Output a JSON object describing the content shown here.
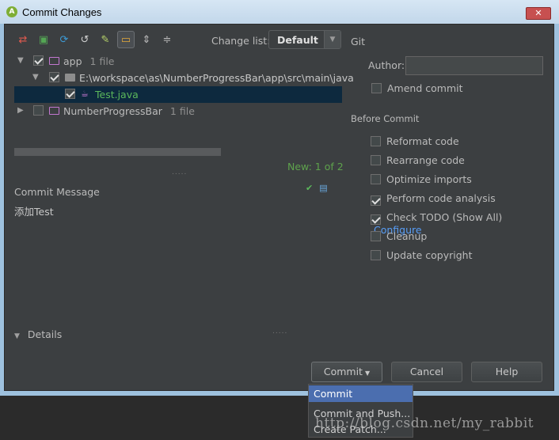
{
  "window": {
    "title": "Commit Changes",
    "close": "✕"
  },
  "toolbar": {
    "icons": [
      "diff-icon",
      "move-icon",
      "refresh-icon",
      "revert-icon",
      "edit-icon",
      "group-by-module-icon",
      "expand-all-icon",
      "collapse-all-icon"
    ],
    "change_list_label": "Change list:",
    "change_list_value": "Default"
  },
  "tree": {
    "rows": [
      {
        "label": "app",
        "hint": "1 file"
      },
      {
        "label": "E:\\workspace\\as\\NumberProgressBar\\app\\src\\main\\java"
      },
      {
        "label": "Test.java"
      },
      {
        "label": "NumberProgressBar",
        "hint": "1 file"
      }
    ],
    "new_counter": "New: 1 of 2"
  },
  "commit_message": {
    "title": "Commit Message",
    "text": "添加Test"
  },
  "details": {
    "label": "Details"
  },
  "git": {
    "title": "Git",
    "author_label": "Author:",
    "author_value": "",
    "amend_label": "Amend commit"
  },
  "before_commit": {
    "title": "Before Commit",
    "options": [
      {
        "label": "Reformat code",
        "checked": false
      },
      {
        "label": "Rearrange code",
        "checked": false
      },
      {
        "label": "Optimize imports",
        "checked": false
      },
      {
        "label": "Perform code analysis",
        "checked": true
      },
      {
        "label": "Check TODO (Show All)",
        "checked": true,
        "link": "Configure"
      },
      {
        "label": "Cleanup",
        "checked": false
      },
      {
        "label": "Update copyright",
        "checked": false
      }
    ]
  },
  "buttons": {
    "commit": "Commit",
    "cancel": "Cancel",
    "help": "Help"
  },
  "commit_menu": [
    "Commit",
    "Commit and Push...",
    "Create Patch..."
  ],
  "watermark": "http://blog.csdn.net/my_rabbit"
}
